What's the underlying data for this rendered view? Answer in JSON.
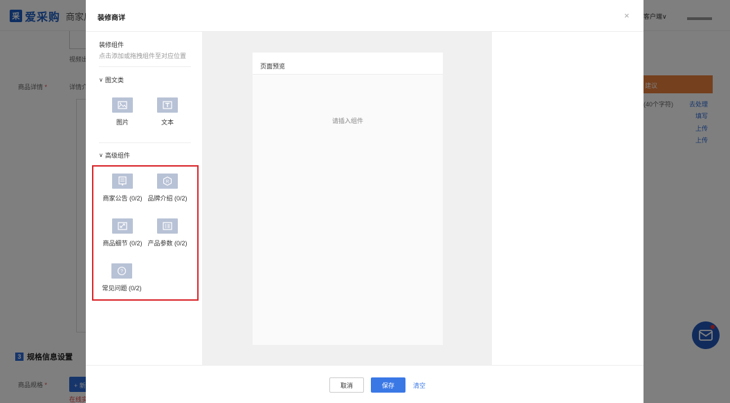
{
  "background": {
    "logo_mark": "采",
    "logo_text": "爱采购",
    "logo_sub": "商家后",
    "client_menu": "客户端∨",
    "video_label": "视频出",
    "detail_label": "商品详情",
    "detail_required": "*",
    "detail_hint": "详情介",
    "section_num": "3",
    "section_title": "规格信息设置",
    "spec_label": "商品规格",
    "spec_required": "*",
    "add_btn": "+ 新",
    "online_text": "在线实",
    "suggest_bar": "建议",
    "char_hint": "(40个字符)",
    "links": [
      "去处理",
      "填写",
      "上传",
      "上传"
    ]
  },
  "modal": {
    "title": "装修商详",
    "close": "×",
    "left": {
      "title": "装修组件",
      "hint": "点击添加或拖拽组件至对应位置",
      "group1": "图文类",
      "group1_items": [
        {
          "label": "图片",
          "icon": "image-icon"
        },
        {
          "label": "文本",
          "icon": "text-icon"
        }
      ],
      "group2": "高级组件",
      "group2_items": [
        {
          "label": "商家公告 (0/2)",
          "icon": "announcement-icon"
        },
        {
          "label": "品牌介绍 (0/2)",
          "icon": "brand-icon"
        },
        {
          "label": "商品细节 (0/2)",
          "icon": "detail-icon"
        },
        {
          "label": "产品参数 (0/2)",
          "icon": "params-icon"
        },
        {
          "label": "常见问题 (0/2)",
          "icon": "faq-icon"
        }
      ]
    },
    "preview": {
      "title": "页面预览",
      "empty": "请插入组件"
    },
    "footer": {
      "cancel": "取消",
      "save": "保存",
      "clear": "清空"
    }
  },
  "colors": {
    "primary": "#3a78e6",
    "highlight": "#d9262b",
    "icon_bg": "#b8c2d6"
  }
}
